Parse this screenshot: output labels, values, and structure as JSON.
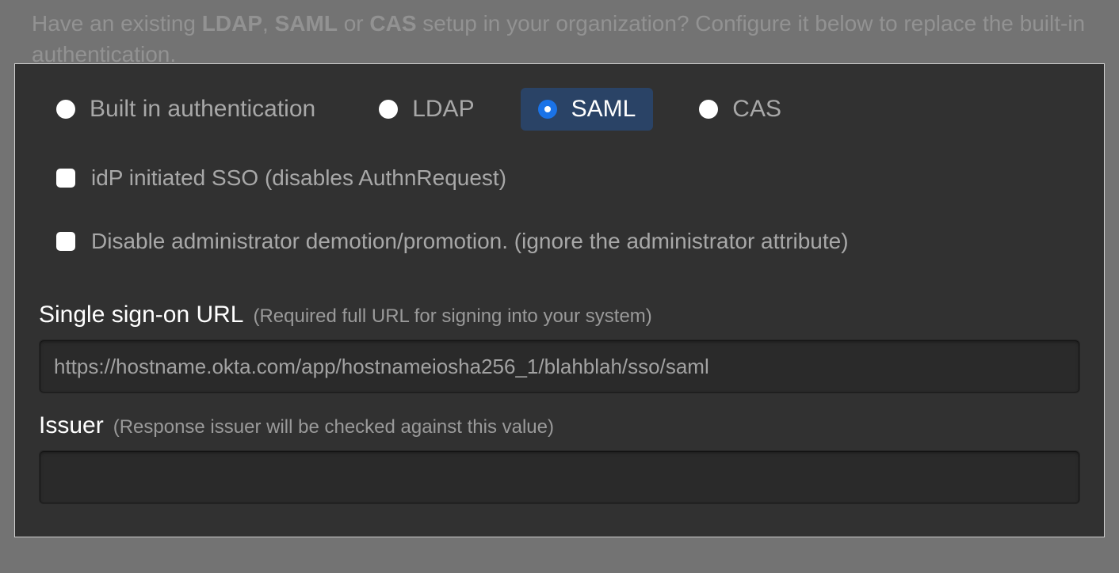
{
  "backdrop": {
    "prefix": "Have an existing ",
    "ldap": "LDAP",
    "sep1": ", ",
    "saml": "SAML",
    "sep2": " or ",
    "cas": "CAS",
    "suffix": " setup in your organization? Configure it below to replace the built-in authentication."
  },
  "auth_modes": {
    "builtin": {
      "label": "Built in authentication",
      "selected": false
    },
    "ldap": {
      "label": "LDAP",
      "selected": false
    },
    "saml": {
      "label": "SAML",
      "selected": true
    },
    "cas": {
      "label": "CAS",
      "selected": false
    }
  },
  "checkboxes": {
    "idp_initiated": {
      "label": "idP initiated SSO (disables AuthnRequest)",
      "checked": false
    },
    "disable_admin": {
      "label": "Disable administrator demotion/promotion. (ignore the administrator attribute)",
      "checked": false
    }
  },
  "fields": {
    "sso_url": {
      "label": "Single sign-on URL",
      "hint": "(Required full URL for signing into your system)",
      "value": "https://hostname.okta.com/app/hostnameiosha256_1/blahblah/sso/saml"
    },
    "issuer": {
      "label": "Issuer",
      "hint": "(Response issuer will be checked against this value)",
      "value": ""
    }
  }
}
